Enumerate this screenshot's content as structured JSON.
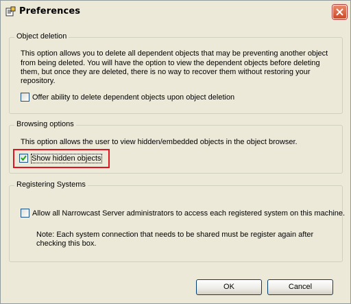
{
  "window": {
    "title": "Preferences",
    "title_icon": "preferences-icon",
    "close_icon": "close-icon"
  },
  "object_deletion": {
    "legend": "Object deletion",
    "description_lines": [
      "This option allows you to delete all dependent objects that may be preventing another object",
      "from being deleted. You will have the option to view the dependent objects before deleting",
      "them, but once they are deleted, there is no way to recover them without restoring your",
      "repository."
    ],
    "checkbox_label": "Offer ability to delete dependent objects upon object deletion",
    "checked": false
  },
  "browsing_options": {
    "legend": "Browsing options",
    "description": "This option allows the user to view hidden/embedded objects in the object browser.",
    "checkbox_label": "Show hidden objects",
    "checked": true
  },
  "registering_systems": {
    "legend": "Registering Systems",
    "checkbox_label": "Allow all Narrowcast Server administrators to access each registered system on this machine.",
    "checked": false,
    "note_lines": [
      "Note: Each system connection that needs to be shared must be register again after",
      "checking this box."
    ]
  },
  "buttons": {
    "ok": "OK",
    "cancel": "Cancel"
  }
}
